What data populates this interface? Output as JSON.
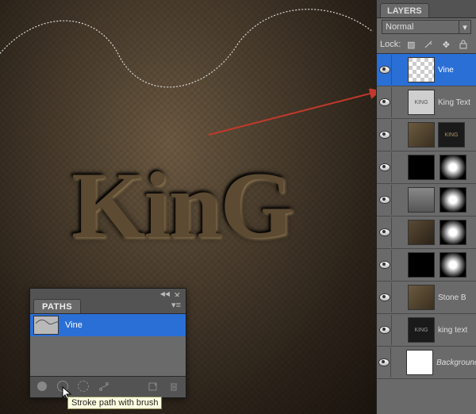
{
  "canvas": {
    "display_text": "KinG"
  },
  "paths_panel": {
    "tab": "PATHS",
    "row_name": "Vine",
    "tooltip": "Stroke path with brush"
  },
  "layers_panel": {
    "tab": "LAYERS",
    "blend_mode": "Normal",
    "lock_label": "Lock:",
    "layers": [
      {
        "name": "Vine",
        "selected": true,
        "thumb": "check",
        "mask": false,
        "italic": false,
        "thumb_label": ""
      },
      {
        "name": "King Text",
        "selected": false,
        "thumb": "txt",
        "mask": false,
        "italic": false,
        "thumb_label": "KING"
      },
      {
        "name": "",
        "selected": false,
        "thumb": "stone",
        "mask": true,
        "mask_label": "KING",
        "italic": false,
        "thumb_label": ""
      },
      {
        "name": "",
        "selected": false,
        "thumb": "black",
        "mask": true,
        "italic": false,
        "thumb_label": ""
      },
      {
        "name": "",
        "selected": false,
        "thumb": "grey",
        "mask": true,
        "italic": false,
        "thumb_label": ""
      },
      {
        "name": "",
        "selected": false,
        "thumb": "stoneB",
        "mask": true,
        "italic": false,
        "thumb_label": ""
      },
      {
        "name": "",
        "selected": false,
        "thumb": "black",
        "mask": true,
        "italic": false,
        "thumb_label": ""
      },
      {
        "name": "Stone B",
        "selected": false,
        "thumb": "stone",
        "mask": false,
        "italic": false,
        "thumb_label": ""
      },
      {
        "name": "king text",
        "selected": false,
        "thumb": "darktxt",
        "mask": false,
        "italic": false,
        "thumb_label": "KING"
      },
      {
        "name": "Background",
        "selected": false,
        "thumb": "white",
        "mask": false,
        "italic": true,
        "thumb_label": ""
      }
    ]
  }
}
